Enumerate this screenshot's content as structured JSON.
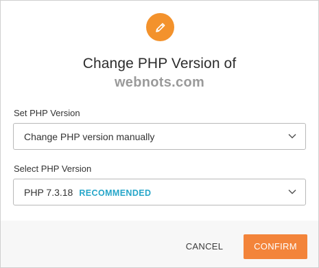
{
  "dialog": {
    "title": "Change PHP Version of",
    "domain": "webnots.com",
    "accent_color": "#f3922c"
  },
  "set_php_version": {
    "label": "Set PHP Version",
    "selected": "Change PHP version manually"
  },
  "select_php_version": {
    "label": "Select PHP Version",
    "selected": "PHP 7.3.18",
    "badge": "RECOMMENDED",
    "badge_color": "#26a6c9"
  },
  "footer": {
    "cancel_label": "CANCEL",
    "confirm_label": "CONFIRM",
    "confirm_color": "#f3843a"
  },
  "icons": {
    "header": "pencil-icon",
    "dropdown": "chevron-down-icon"
  }
}
